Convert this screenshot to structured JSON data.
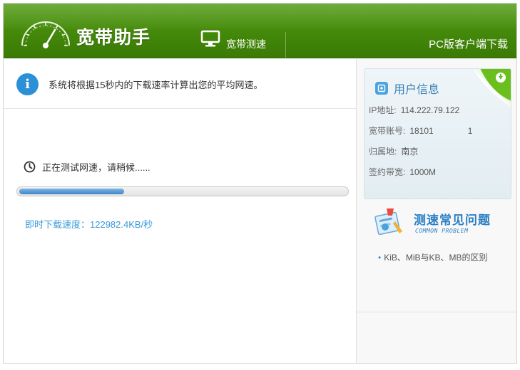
{
  "header": {
    "app_title": "宽带助手",
    "tab_speed_test": "宽带测速",
    "download_link": "PC版客户端下载"
  },
  "notice": {
    "text": "系统将根据15秒内的下载速率计算出您的平均网速。"
  },
  "test": {
    "status": "正在测试网速，请稍候......",
    "progress_fraction": 0.32,
    "speed_text": "即时下载速度：122982.4KB/秒"
  },
  "user_info": {
    "title": "用户信息",
    "rows": [
      {
        "label": "IP地址:",
        "value": "114.222.79.122"
      },
      {
        "label": "宽带账号:",
        "value": "18101　　　　1"
      },
      {
        "label": "归属地:",
        "value": "南京"
      },
      {
        "label": "签约带宽:",
        "value": "1000M"
      }
    ]
  },
  "faq": {
    "title": "测速常见问题",
    "subtitle": "COMMON PROBLEM",
    "link": "KiB、MiB与KB、MB的区别"
  },
  "colors": {
    "header_green": "#4f9a10",
    "accent_blue": "#2b90d6",
    "link_blue": "#3a9ad9"
  }
}
